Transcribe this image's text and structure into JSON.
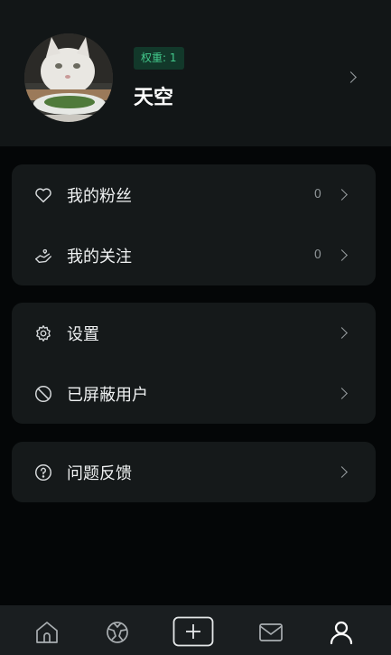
{
  "profile": {
    "badge": "权重: 1",
    "username": "天空"
  },
  "menu": {
    "card1": [
      {
        "label": "我的粉丝",
        "count": "0",
        "icon": "heart-icon"
      },
      {
        "label": "我的关注",
        "count": "0",
        "icon": "hand-heart-icon"
      }
    ],
    "card2": [
      {
        "label": "设置",
        "icon": "gear-icon"
      },
      {
        "label": "已屏蔽用户",
        "icon": "block-icon"
      }
    ],
    "card3": [
      {
        "label": "问题反馈",
        "icon": "question-icon"
      }
    ]
  },
  "tabbar": [
    "home-icon",
    "explore-icon",
    "add-icon",
    "mail-icon",
    "profile-icon"
  ],
  "colors": {
    "accent": "#43c98c",
    "background": "#040607",
    "card": "#15191a"
  }
}
